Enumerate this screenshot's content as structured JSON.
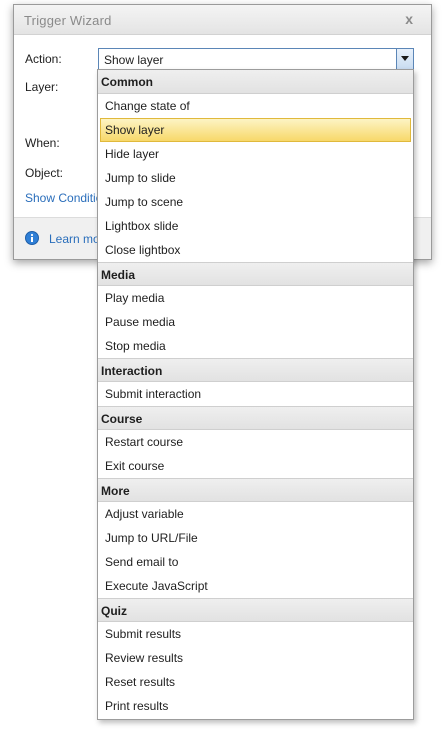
{
  "window": {
    "title": "Trigger Wizard",
    "close_glyph": "x"
  },
  "form": {
    "action_label": "Action:",
    "layer_label": "Layer:",
    "when_label": "When:",
    "object_label": "Object:",
    "action_value": "Show layer",
    "show_conditions": "Show Condition",
    "learn_more": "Learn mor"
  },
  "dropdown": {
    "groups": [
      {
        "header": "Common",
        "items": [
          "Change state of",
          "Show layer",
          "Hide layer",
          "Jump to slide",
          "Jump to scene",
          "Lightbox slide",
          "Close lightbox"
        ]
      },
      {
        "header": "Media",
        "items": [
          "Play media",
          "Pause media",
          "Stop media"
        ]
      },
      {
        "header": "Interaction",
        "items": [
          "Submit interaction"
        ]
      },
      {
        "header": "Course",
        "items": [
          "Restart course",
          "Exit course"
        ]
      },
      {
        "header": "More",
        "items": [
          "Adjust variable",
          "Jump to URL/File",
          "Send email to",
          "Execute JavaScript"
        ]
      },
      {
        "header": "Quiz",
        "items": [
          "Submit results",
          "Review results",
          "Reset results",
          "Print results"
        ]
      }
    ],
    "selected": "Show layer"
  },
  "colors": {
    "link": "#2a6ebb",
    "selection_top": "#fdf4c4",
    "selection_bottom": "#f7d86a",
    "combo_border": "#5b86b7"
  },
  "icons": {
    "info": "info-icon",
    "dropdown_arrow": "chevron-down-icon",
    "close": "close-icon"
  }
}
